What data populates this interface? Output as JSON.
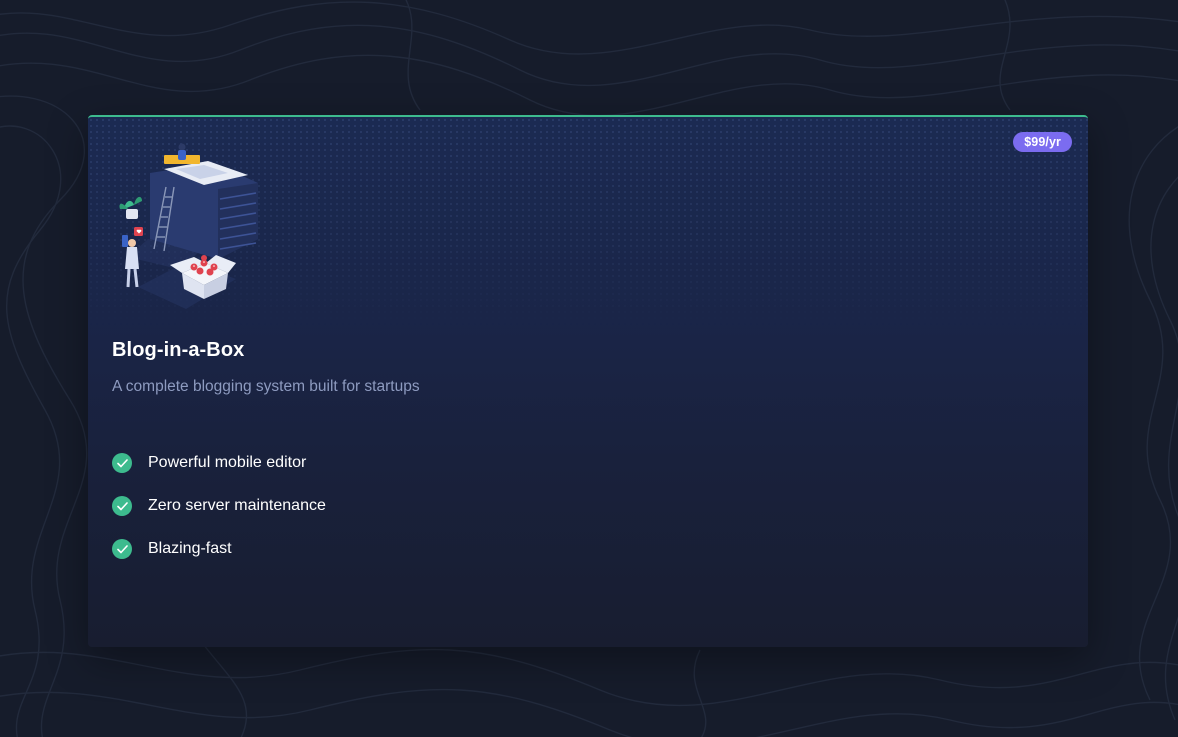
{
  "card": {
    "price": "$99/yr",
    "title": "Blog-in-a-Box",
    "subtitle": "A complete blogging system built for startups",
    "features": [
      "Powerful mobile editor",
      "Zero server maintenance",
      "Blazing-fast"
    ],
    "illustration": "blog-server-box-illustration"
  },
  "icons": {
    "feature_check": "check-circle-icon"
  },
  "colors": {
    "page_background": "#161c2b",
    "card_top_border": "#3dbb8e",
    "price_badge": "#7b6cf0",
    "check_circle": "#3dbb8e",
    "subtitle_text": "#8e9bc0"
  }
}
